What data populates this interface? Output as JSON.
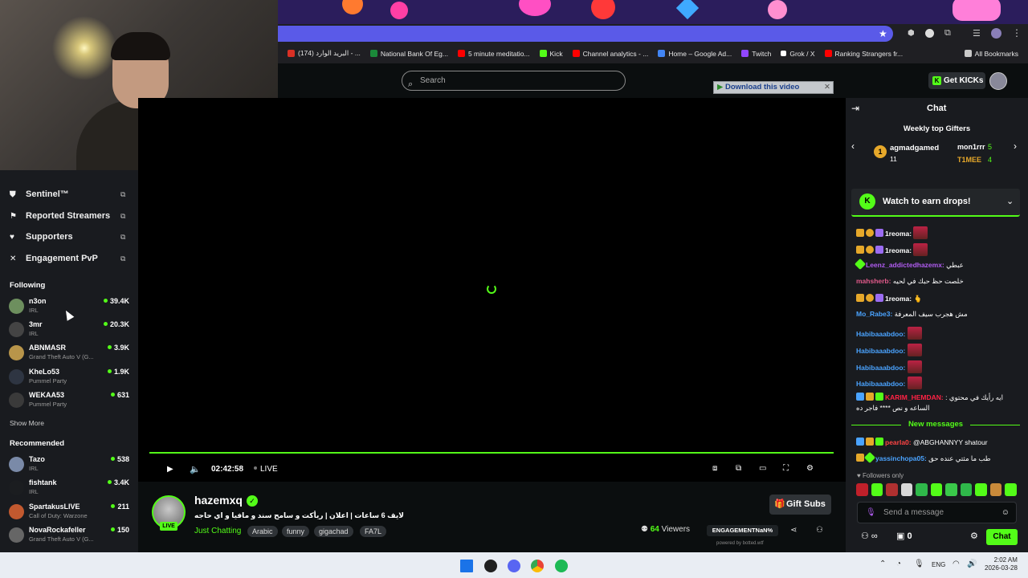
{
  "browser": {
    "bookmarks": [
      {
        "label": "(174) البريد الوارد - ...",
        "color": "#d93025"
      },
      {
        "label": "National Bank Of Eg...",
        "color": "#1b8a3a"
      },
      {
        "label": "5 minute meditatio...",
        "color": "#ff0000"
      },
      {
        "label": "Kick",
        "color": "#53fc18"
      },
      {
        "label": "Channel analytics - ...",
        "color": "#ff0000"
      },
      {
        "label": "Home – Google Ad...",
        "color": "#4285f4"
      },
      {
        "label": "Twitch",
        "color": "#9146ff"
      },
      {
        "label": "Grok / X",
        "color": "#ffffff"
      },
      {
        "label": "Ranking Strangers fr...",
        "color": "#ff0000"
      }
    ],
    "all_bookmarks": "All Bookmarks"
  },
  "header": {
    "search_placeholder": "Search",
    "download_label": "Download this video",
    "get_kicks": "Get KICKs"
  },
  "sidebar": {
    "nav": [
      {
        "label": "Sentinel™",
        "icon": "shield-icon"
      },
      {
        "label": "Reported Streamers",
        "icon": "flag-icon"
      },
      {
        "label": "Supporters",
        "icon": "heart-icon"
      },
      {
        "label": "Engagement PvP",
        "icon": "swords-icon"
      }
    ],
    "following_title": "Following",
    "following": [
      {
        "name": "n3on",
        "category": "IRL",
        "viewers": "39.4K"
      },
      {
        "name": "3mr",
        "category": "IRL",
        "viewers": "20.3K"
      },
      {
        "name": "ABNMASR",
        "category": "Grand Theft Auto V (G...",
        "viewers": "3.9K"
      },
      {
        "name": "KheLo53",
        "category": "Pummel Party",
        "viewers": "1.9K"
      },
      {
        "name": "WEKAA53",
        "category": "Pummel Party",
        "viewers": "631"
      }
    ],
    "show_more": "Show More",
    "recommended_title": "Recommended",
    "recommended": [
      {
        "name": "Tazo",
        "category": "IRL",
        "viewers": "538"
      },
      {
        "name": "fishtank",
        "category": "IRL",
        "viewers": "3.4K"
      },
      {
        "name": "SpartakusLIVE",
        "category": "Call of Duty: Warzone",
        "viewers": "211"
      },
      {
        "name": "NovaRockafeller",
        "category": "Grand Theft Auto V (G...",
        "viewers": "150"
      }
    ]
  },
  "player": {
    "time": "02:42:58",
    "live_label": "LIVE"
  },
  "stream": {
    "streamer": "hazemxq",
    "live_badge": "LIVE",
    "title": "لايف 6 ساعات | اعلان | ريأكت و سامح سند و مافيا و اي حاجه",
    "category": "Just Chatting",
    "tags": [
      "Arabic",
      "funny",
      "gigachad",
      "FA7L"
    ],
    "gift_subs": "Gift Subs",
    "viewer_count": "64",
    "viewers_label": "Viewers",
    "engagement": "ENGAGEMENTNaN%",
    "powered_by": "powered by botted.wtf"
  },
  "chat": {
    "title": "Chat",
    "gifters_title": "Weekly top Gifters",
    "gifters": [
      {
        "rank": "1",
        "name": "agmadgamed",
        "count": "11"
      },
      {
        "name": "mon1rrr",
        "count": "5"
      },
      {
        "name": "T1MEE",
        "count": "4"
      }
    ],
    "drops_label": "Watch to earn drops!",
    "messages": [
      {
        "user": "1reoma:",
        "color": "#ffffff",
        "text": "",
        "emote": true
      },
      {
        "user": "1reoma:",
        "color": "#ffffff",
        "text": "",
        "emote": true
      },
      {
        "user": "Leenz_addictedhazemx:",
        "color": "#b05cf0",
        "text": "عبطي",
        "emote": false
      },
      {
        "user": "mahsherb:",
        "color": "#e05a8a",
        "text": "خلصت حظ حبك في لحيه",
        "emote": false
      },
      {
        "user": "1reoma:",
        "color": "#ffffff",
        "text": "🫰",
        "emote": false
      },
      {
        "user": "Mo_Rabe3:",
        "color": "#4aa3ff",
        "text": "مش هجرب سيف المعرفة",
        "emote": false
      },
      {
        "user": "Habibaaabdoo:",
        "color": "#4aa3ff",
        "text": "",
        "emote": true
      },
      {
        "user": "Habibaaabdoo:",
        "color": "#4aa3ff",
        "text": "",
        "emote": true
      },
      {
        "user": "Habibaaabdoo:",
        "color": "#4aa3ff",
        "text": "",
        "emote": true
      },
      {
        "user": "Habibaaabdoo:",
        "color": "#4aa3ff",
        "text": "",
        "emote": true
      },
      {
        "user": "KARIM_HEMDAN:",
        "color": "#ff2244",
        "text": ": ايه رأيك في محتوي",
        "emote": false
      }
    ],
    "karim_line2": "الساعه و نص **** فاجر ده",
    "new_messages": "New messages",
    "new": [
      {
        "user": "pearla0:",
        "color": "#ff4444",
        "text": "@ABGHANNYY shatour"
      },
      {
        "user": "yassinchopa05:",
        "color": "#4aa3ff",
        "text": "طب ما مثتي عنده حق"
      }
    ],
    "followers_only": "Followers only",
    "input_placeholder": "Send a message",
    "chat_button": "Chat",
    "points": "0"
  },
  "taskbar": {
    "lang": "ENG",
    "time": "2:02 AM",
    "date": "2026-03-28"
  }
}
